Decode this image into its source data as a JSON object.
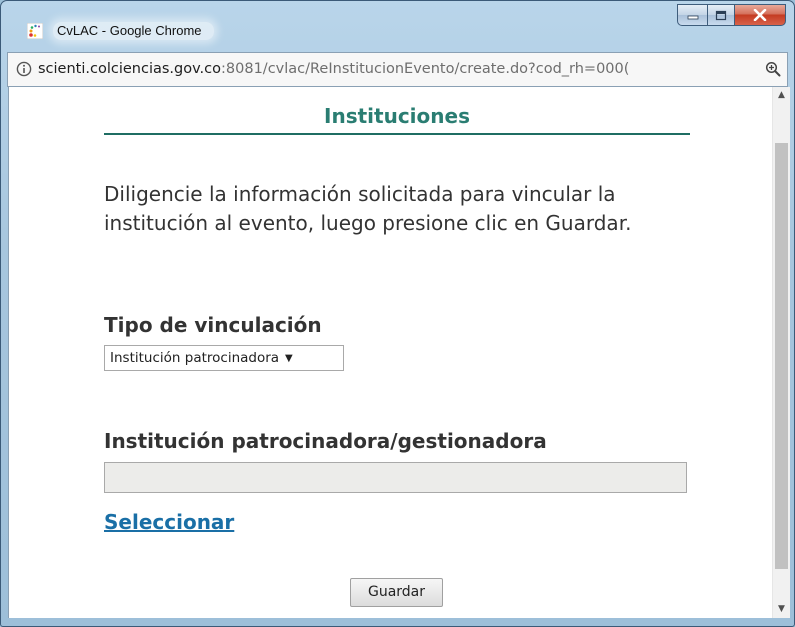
{
  "window": {
    "title": "CvLAC - Google Chrome",
    "accent_color": "#2a7d72",
    "link_color": "#1a6fa6"
  },
  "titlebar_buttons": {
    "minimize_icon": "minimize-icon",
    "maximize_icon": "maximize-icon",
    "close_icon": "close-icon"
  },
  "address_bar": {
    "host": "scienti.colciencias.gov.co",
    "path": ":8081/cvlac/ReInstitucionEvento/create.do?cod_rh=000("
  },
  "page": {
    "heading": "Instituciones",
    "instructions": "Diligencie la información solicitada para vincular la institución al evento, luego presione clic en Guardar.",
    "tipo_label": "Tipo de vinculación",
    "tipo_selected": "Institución patrocinadora",
    "institucion_label": "Institución patrocinadora/gestionadora",
    "institucion_value": "",
    "select_link": "Seleccionar",
    "save_button": "Guardar"
  }
}
